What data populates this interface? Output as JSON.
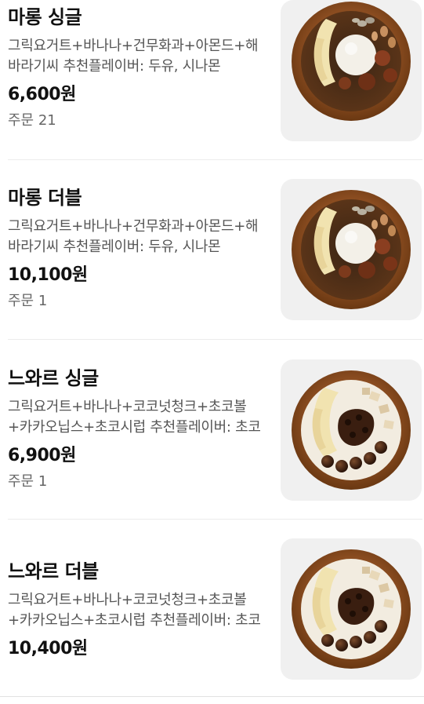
{
  "menu": {
    "items": [
      {
        "name": "마롱 싱글",
        "description": "그릭요거트+바나나+건무화과+아몬드+해바라기씨 추천플레이버: 두유, 시나몬",
        "price": "6,600원",
        "orders": "주문 21",
        "image_icon": "marron-bowl-icon"
      },
      {
        "name": "마롱 더블",
        "description": "그릭요거트+바나나+건무화과+아몬드+해바라기씨 추천플레이버: 두유, 시나몬",
        "price": "10,100원",
        "orders": "주문 1",
        "image_icon": "marron-bowl-icon"
      },
      {
        "name": "느와르 싱글",
        "description": "그릭요거트+바나나+코코넛청크+초코볼+카카오닙스+초코시럽 추천플레이버: 초코",
        "price": "6,900원",
        "orders": "주문 1",
        "image_icon": "noir-bowl-icon"
      },
      {
        "name": "느와르 더블",
        "description": "그릭요거트+바나나+코코넛청크+초코볼+카카오닙스+초코시럽 추천플레이버: 초코",
        "price": "10,400원",
        "orders": "",
        "image_icon": "noir-bowl-icon"
      }
    ]
  },
  "colors": {
    "text_primary": "#111111",
    "text_secondary": "#555555",
    "thumb_background": "#f0f0f0",
    "divider": "#ececec"
  }
}
